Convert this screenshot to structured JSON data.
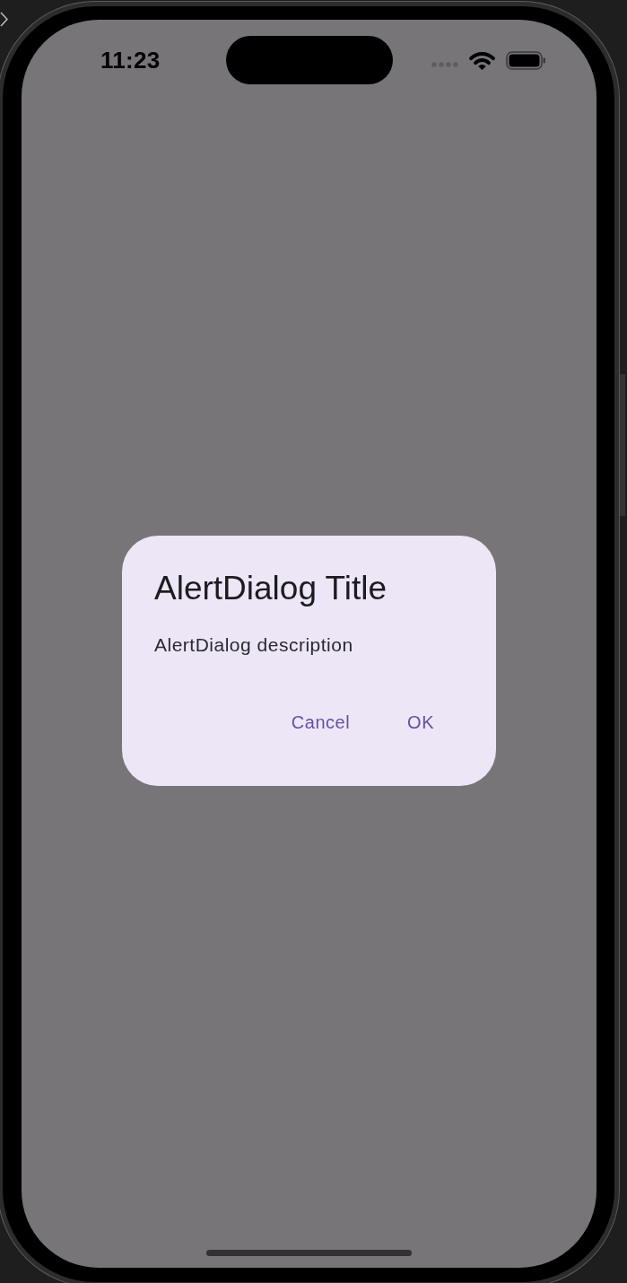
{
  "status_bar": {
    "time": "11:23"
  },
  "dialog": {
    "title": "AlertDialog Title",
    "description": "AlertDialog description",
    "buttons": [
      {
        "label": "Cancel"
      },
      {
        "label": "OK"
      }
    ]
  }
}
